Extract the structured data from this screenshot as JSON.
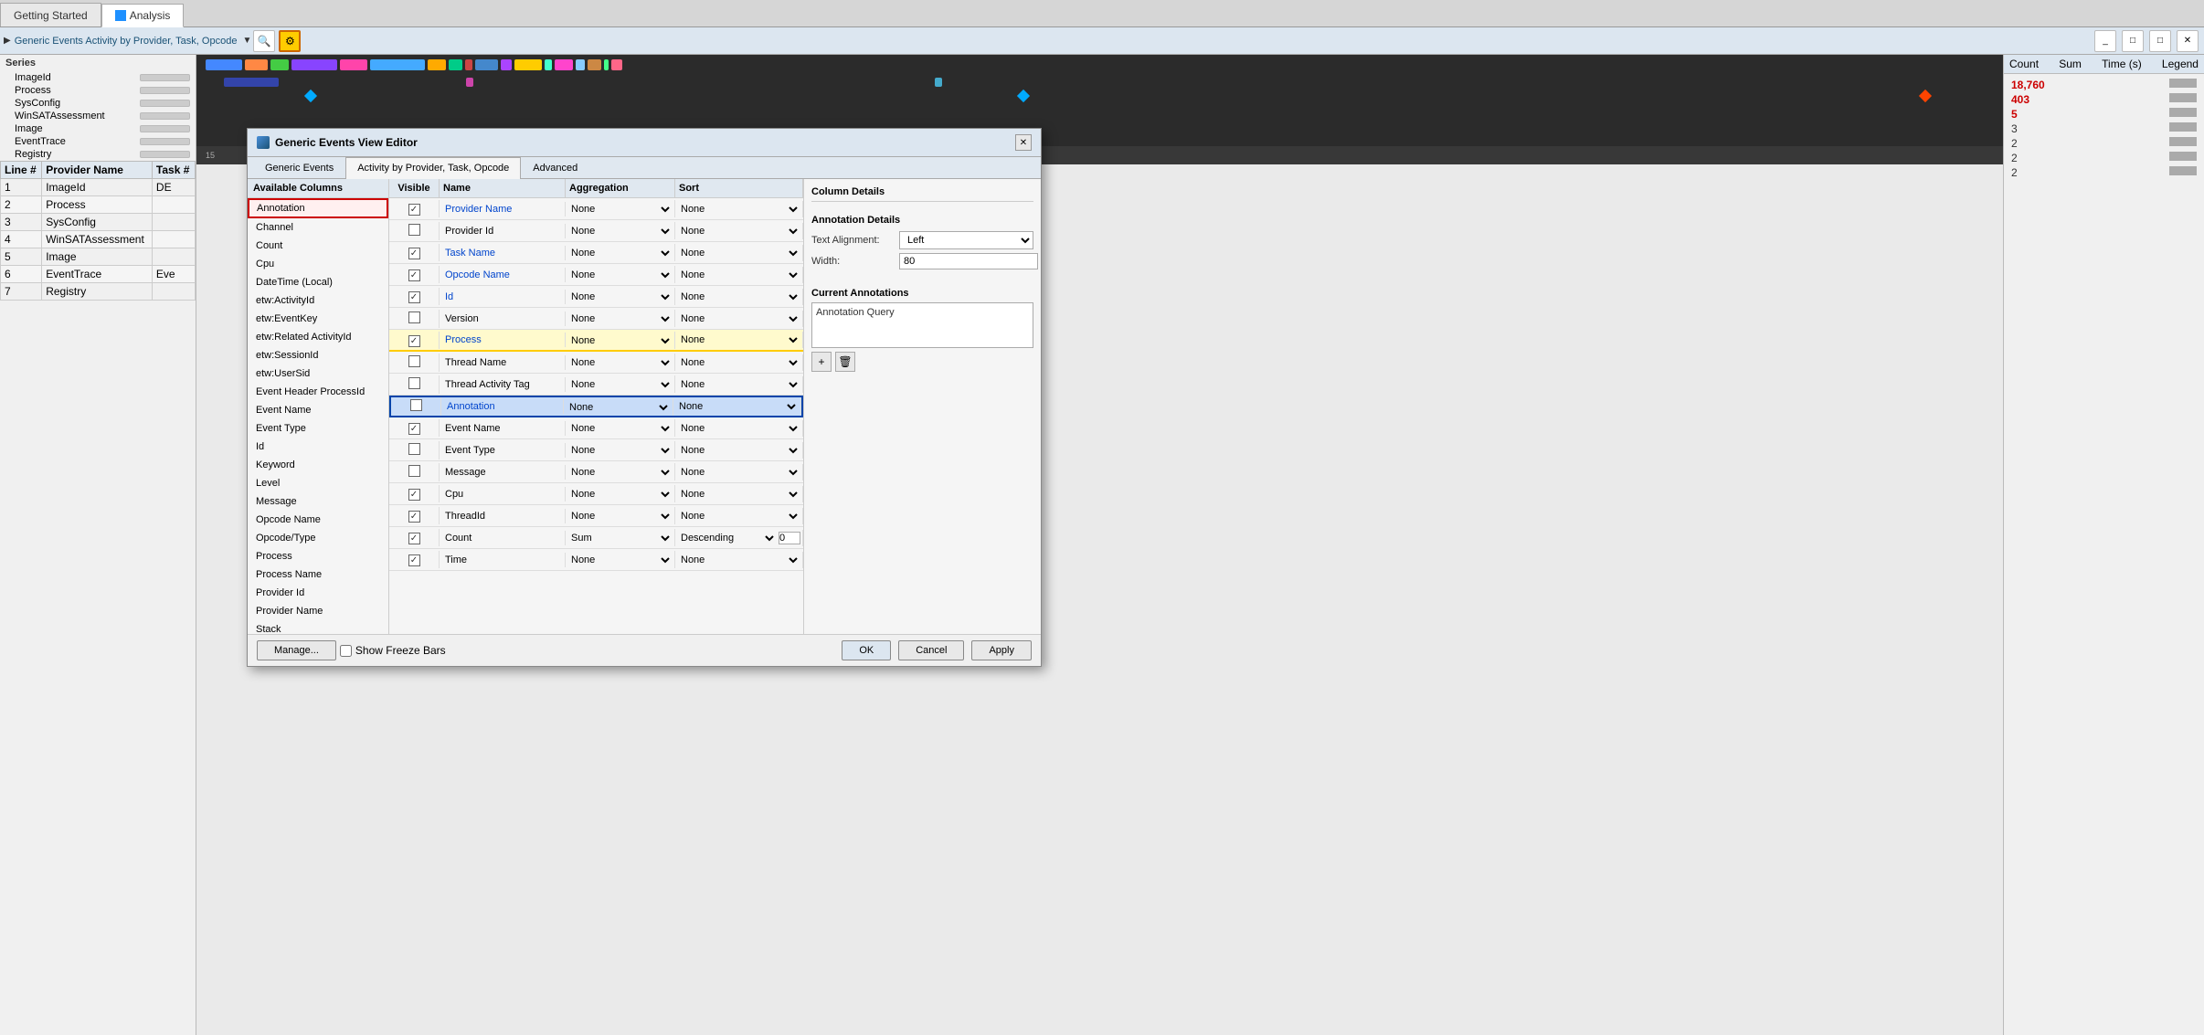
{
  "tabs": [
    {
      "label": "Getting Started",
      "active": false
    },
    {
      "label": "Analysis",
      "active": true,
      "icon": true
    }
  ],
  "toolbar": {
    "label": "Generic Events  Activity by Provider, Task, Opcode",
    "search_icon": "🔍",
    "settings_icon": "⚙"
  },
  "sidebar": {
    "series_title": "Series",
    "items": [
      {
        "label": "ImageId",
        "has_arrow": false
      },
      {
        "label": "Process",
        "has_arrow": true
      },
      {
        "label": "SysConfig",
        "has_arrow": false
      },
      {
        "label": "WinSATAssessment",
        "has_arrow": false
      },
      {
        "label": "Image",
        "has_arrow": false
      },
      {
        "label": "EventTrace",
        "has_arrow": false
      },
      {
        "label": "Registry",
        "has_arrow": false
      }
    ]
  },
  "line_table": {
    "headers": [
      "Line #",
      "Provider Name",
      "Task #"
    ],
    "rows": [
      {
        "line": "1",
        "provider": "ImageId",
        "task": "DE"
      },
      {
        "line": "2",
        "provider": "Process",
        "task": ""
      },
      {
        "line": "3",
        "provider": "SysConfig",
        "task": ""
      },
      {
        "line": "4",
        "provider": "WinSATAssessment",
        "task": ""
      },
      {
        "line": "5",
        "provider": "Image",
        "task": ""
      },
      {
        "line": "6",
        "provider": "EventTrace",
        "task": "Eve"
      },
      {
        "line": "7",
        "provider": "Registry",
        "task": ""
      }
    ]
  },
  "right_panel": {
    "headers": [
      "Count",
      "Sum",
      "Time (s)",
      "Legend"
    ],
    "rows": [
      {
        "count": "18,760",
        "is_red": true
      },
      {
        "count": "403",
        "is_red": true
      },
      {
        "count": "5",
        "is_red": true
      },
      {
        "count": "3",
        "is_red": false
      },
      {
        "count": "2",
        "is_red": false
      },
      {
        "count": "2",
        "is_red": false
      },
      {
        "count": "2",
        "is_red": false
      }
    ]
  },
  "modal": {
    "title": "Generic Events View Editor",
    "tabs": [
      "Generic Events",
      "Activity by Provider, Task, Opcode",
      "Advanced"
    ],
    "active_tab": 1,
    "left_panel": {
      "header": "Available Columns",
      "items": [
        {
          "label": "Annotation",
          "highlighted": true
        },
        {
          "label": "Channel"
        },
        {
          "label": "Count"
        },
        {
          "label": "Cpu"
        },
        {
          "label": "DateTime (Local)"
        },
        {
          "label": "etw:ActivityId"
        },
        {
          "label": "etw:EventKey"
        },
        {
          "label": "etw:Related ActivityId"
        },
        {
          "label": "etw:SessionId"
        },
        {
          "label": "etw:UserSid"
        },
        {
          "label": "Event Header ProcessId"
        },
        {
          "label": "Event Name"
        },
        {
          "label": "Event Type"
        },
        {
          "label": "Id"
        },
        {
          "label": "Keyword"
        },
        {
          "label": "Level"
        },
        {
          "label": "Message"
        },
        {
          "label": "Opcode Name"
        },
        {
          "label": "Opcode/Type"
        },
        {
          "label": "Process"
        },
        {
          "label": "Process Name"
        },
        {
          "label": "Provider Id"
        },
        {
          "label": "Provider Name"
        },
        {
          "label": "Stack"
        }
      ]
    },
    "grid": {
      "columns": [
        "Visible",
        "Name",
        "Aggregation",
        "Sort"
      ],
      "rows": [
        {
          "visible": true,
          "name": "Provider Name",
          "name_blue": true,
          "agg": "None",
          "sort": "None",
          "yellow": false,
          "blue_hl": false
        },
        {
          "visible": false,
          "name": "Provider Id",
          "name_blue": false,
          "agg": "None",
          "sort": "None",
          "yellow": false,
          "blue_hl": false
        },
        {
          "visible": true,
          "name": "Task Name",
          "name_blue": true,
          "agg": "None",
          "sort": "None",
          "yellow": false,
          "blue_hl": false
        },
        {
          "visible": true,
          "name": "Opcode Name",
          "name_blue": true,
          "agg": "None",
          "sort": "None",
          "yellow": false,
          "blue_hl": false
        },
        {
          "visible": true,
          "name": "Id",
          "name_blue": true,
          "agg": "None",
          "sort": "None",
          "yellow": false,
          "blue_hl": false
        },
        {
          "visible": false,
          "name": "Version",
          "name_blue": false,
          "agg": "None",
          "sort": "None",
          "yellow": false,
          "blue_hl": false
        },
        {
          "visible": true,
          "name": "Process",
          "name_blue": true,
          "agg": "None",
          "sort": "None",
          "yellow": true,
          "blue_hl": false
        },
        {
          "visible": false,
          "name": "Thread Name",
          "name_blue": false,
          "agg": "None",
          "sort": "None",
          "yellow": false,
          "blue_hl": false
        },
        {
          "visible": false,
          "name": "Thread Activity Tag",
          "name_blue": false,
          "agg": "None",
          "sort": "None",
          "yellow": false,
          "blue_hl": false
        },
        {
          "visible": false,
          "name": "Annotation",
          "name_blue": true,
          "agg": "None",
          "sort": "None",
          "yellow": false,
          "blue_hl": true
        },
        {
          "visible": true,
          "name": "Event Name",
          "name_blue": false,
          "agg": "None",
          "sort": "None",
          "yellow": false,
          "blue_hl": false
        },
        {
          "visible": false,
          "name": "Event Type",
          "name_blue": false,
          "agg": "None",
          "sort": "None",
          "yellow": false,
          "blue_hl": false
        },
        {
          "visible": false,
          "name": "Message",
          "name_blue": false,
          "agg": "None",
          "sort": "None",
          "yellow": false,
          "blue_hl": false
        },
        {
          "visible": true,
          "name": "Cpu",
          "name_blue": false,
          "agg": "None",
          "sort": "None",
          "yellow": false,
          "blue_hl": false
        },
        {
          "visible": true,
          "name": "ThreadId",
          "name_blue": false,
          "agg": "None",
          "sort": "None",
          "yellow": false,
          "blue_hl": false
        },
        {
          "visible": true,
          "name": "Count",
          "name_blue": false,
          "agg": "Sum",
          "sort": "Descending",
          "sort_num": "0",
          "yellow": false,
          "blue_hl": false,
          "has_num": true
        },
        {
          "visible": true,
          "name": "Time",
          "name_blue": false,
          "agg": "None",
          "sort": "None",
          "yellow": false,
          "blue_hl": false
        }
      ]
    },
    "col_details": {
      "section_title": "Column Details",
      "annotation_title": "Annotation Details",
      "text_align_label": "Text Alignment:",
      "text_align_value": "Left",
      "width_label": "Width:",
      "width_value": "80",
      "current_annotations_title": "Current Annotations",
      "annotation_query": "Annotation Query"
    },
    "footer": {
      "manage_label": "Manage...",
      "show_freeze_label": "Show Freeze Bars",
      "ok_label": "OK",
      "cancel_label": "Cancel",
      "apply_label": "Apply"
    }
  }
}
